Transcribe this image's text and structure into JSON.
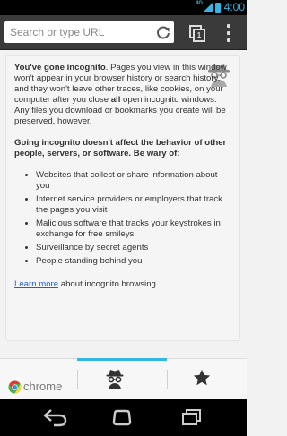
{
  "status_bar": {
    "network": "4G",
    "time": "4:00"
  },
  "toolbar": {
    "search_placeholder": "Search or type URL",
    "tab_count": "1"
  },
  "incognito_page": {
    "intro_bold": "You've gone incognito",
    "intro_part1": ". Pages you view in this window won't appear in your browser history or search history, and they won't leave other traces, like cookies, on your computer after you close ",
    "intro_all": "all",
    "intro_part2": " open incognito windows. Any files you download or bookmarks you create will be preserved, however.",
    "warning": "Going incognito doesn't affect the behavior of other people, servers, or software. Be wary of:",
    "risks": [
      "Websites that collect or share information about you",
      "Internet service providers or employers that track the pages you visit",
      "Malicious software that tracks your keystrokes in exchange for free smileys",
      "Surveillance by secret agents",
      "People standing behind you"
    ],
    "learn_more_link": "Learn more",
    "learn_more_suffix": " about incognito browsing."
  },
  "bottom_bar": {
    "chrome_label": "chrome"
  },
  "colors": {
    "accent": "#33b5e5",
    "toolbar": "#3a3a3a",
    "link": "#1c61d8"
  }
}
